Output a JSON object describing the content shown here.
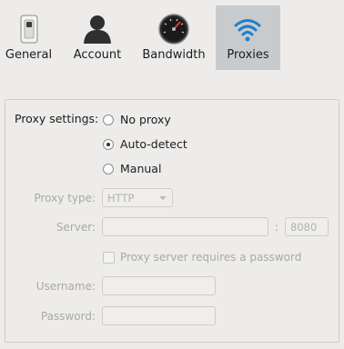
{
  "tabs": [
    {
      "label": "General",
      "icon": "switch-icon",
      "active": false
    },
    {
      "label": "Account",
      "icon": "user-icon",
      "active": false
    },
    {
      "label": "Bandwidth",
      "icon": "speedometer-icon",
      "active": false
    },
    {
      "label": "Proxies",
      "icon": "wifi-icon",
      "active": true
    }
  ],
  "proxy": {
    "settings_label": "Proxy settings:",
    "options": [
      {
        "label": "No proxy",
        "selected": false
      },
      {
        "label": "Auto-detect",
        "selected": true
      },
      {
        "label": "Manual",
        "selected": false
      }
    ],
    "type_label": "Proxy type:",
    "type_value": "HTTP",
    "server_label": "Server:",
    "server_value": "",
    "port_value": "8080",
    "requires_password_label": "Proxy server requires a password",
    "requires_password_checked": false,
    "username_label": "Username:",
    "username_value": "",
    "password_label": "Password:",
    "password_value": ""
  },
  "colors": {
    "active_tab_bg": "#c8cbcd",
    "wifi_blue": "#1e7fce"
  }
}
